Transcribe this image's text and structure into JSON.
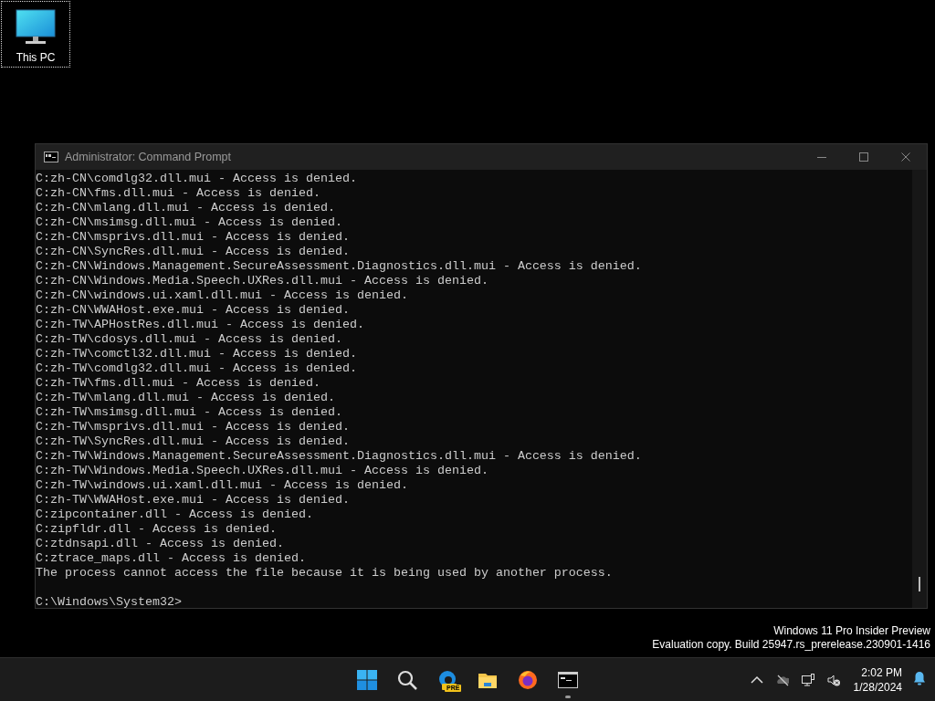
{
  "desktop_icons": [
    {
      "label": "This PC",
      "selected": true
    }
  ],
  "console_window": {
    "title": "Administrator: Command Prompt",
    "lines": [
      "C:zh-CN\\comdlg32.dll.mui - Access is denied.",
      "C:zh-CN\\fms.dll.mui - Access is denied.",
      "C:zh-CN\\mlang.dll.mui - Access is denied.",
      "C:zh-CN\\msimsg.dll.mui - Access is denied.",
      "C:zh-CN\\msprivs.dll.mui - Access is denied.",
      "C:zh-CN\\SyncRes.dll.mui - Access is denied.",
      "C:zh-CN\\Windows.Management.SecureAssessment.Diagnostics.dll.mui - Access is denied.",
      "C:zh-CN\\Windows.Media.Speech.UXRes.dll.mui - Access is denied.",
      "C:zh-CN\\windows.ui.xaml.dll.mui - Access is denied.",
      "C:zh-CN\\WWAHost.exe.mui - Access is denied.",
      "C:zh-TW\\APHostRes.dll.mui - Access is denied.",
      "C:zh-TW\\cdosys.dll.mui - Access is denied.",
      "C:zh-TW\\comctl32.dll.mui - Access is denied.",
      "C:zh-TW\\comdlg32.dll.mui - Access is denied.",
      "C:zh-TW\\fms.dll.mui - Access is denied.",
      "C:zh-TW\\mlang.dll.mui - Access is denied.",
      "C:zh-TW\\msimsg.dll.mui - Access is denied.",
      "C:zh-TW\\msprivs.dll.mui - Access is denied.",
      "C:zh-TW\\SyncRes.dll.mui - Access is denied.",
      "C:zh-TW\\Windows.Management.SecureAssessment.Diagnostics.dll.mui - Access is denied.",
      "C:zh-TW\\Windows.Media.Speech.UXRes.dll.mui - Access is denied.",
      "C:zh-TW\\windows.ui.xaml.dll.mui - Access is denied.",
      "C:zh-TW\\WWAHost.exe.mui - Access is denied.",
      "C:zipcontainer.dll - Access is denied.",
      "C:zipfldr.dll - Access is denied.",
      "C:ztdnsapi.dll - Access is denied.",
      "C:ztrace_maps.dll - Access is denied.",
      "The process cannot access the file because it is being used by another process."
    ],
    "prompt": "C:\\Windows\\System32>"
  },
  "watermark": [
    "Windows 11 Pro Insider Preview",
    "Evaluation copy. Build 25947.rs_prerelease.230901-1416"
  ],
  "taskbar": {
    "apps": [
      {
        "kind": "start",
        "running": false
      },
      {
        "kind": "search",
        "running": false
      },
      {
        "kind": "edge",
        "badge": "PRE",
        "running": false
      },
      {
        "kind": "explorer",
        "running": false
      },
      {
        "kind": "firefox",
        "running": false
      },
      {
        "kind": "terminal",
        "running": true
      }
    ],
    "tray": [
      {
        "kind": "chevron"
      },
      {
        "kind": "cloud"
      },
      {
        "kind": "network"
      },
      {
        "kind": "volume"
      }
    ],
    "time": "2:02 PM",
    "date": "1/28/2024"
  }
}
